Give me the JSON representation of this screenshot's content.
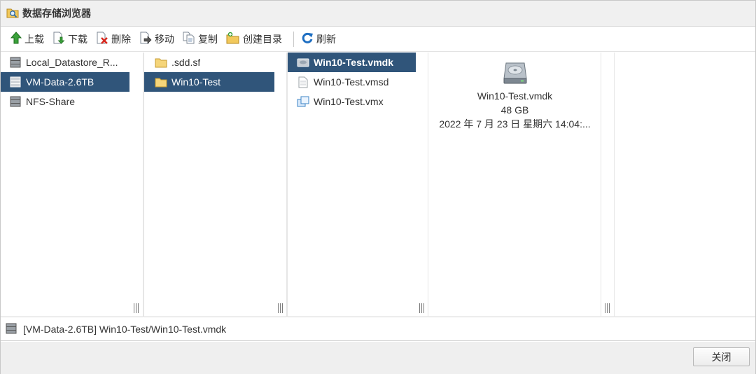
{
  "window": {
    "title": "数据存储浏览器"
  },
  "toolbar": {
    "upload": "上载",
    "download": "下载",
    "delete": "删除",
    "move": "移动",
    "copy": "复制",
    "mkdir": "创建目录",
    "refresh": "刷新"
  },
  "datastores": [
    {
      "label": "Local_Datastore_R...",
      "icon": "datastore-icon",
      "selected": false
    },
    {
      "label": "VM-Data-2.6TB",
      "icon": "datastore-icon",
      "selected": true
    },
    {
      "label": "NFS-Share",
      "icon": "datastore-icon",
      "selected": false
    }
  ],
  "folders": [
    {
      "label": ".sdd.sf",
      "icon": "folder-icon",
      "selected": false
    },
    {
      "label": "Win10-Test",
      "icon": "folder-icon",
      "selected": true
    }
  ],
  "files": [
    {
      "label": "Win10-Test.vmdk",
      "icon": "disk-file-icon",
      "selected": true
    },
    {
      "label": "Win10-Test.vmsd",
      "icon": "document-icon",
      "selected": false
    },
    {
      "label": "Win10-Test.vmx",
      "icon": "vm-config-icon",
      "selected": false
    }
  ],
  "preview": {
    "icon": "hard-disk-icon",
    "name": "Win10-Test.vmdk",
    "size": "48 GB",
    "modified": "2022 年 7 月 23 日 星期六 14:04:..."
  },
  "path": {
    "text": "[VM-Data-2.6TB] Win10-Test/Win10-Test.vmdk",
    "icon": "datastore-icon"
  },
  "footer": {
    "close": "关闭"
  },
  "colors": {
    "selection": "#30557a",
    "titlebar": "#f0f0f0",
    "footer": "#efefef"
  }
}
